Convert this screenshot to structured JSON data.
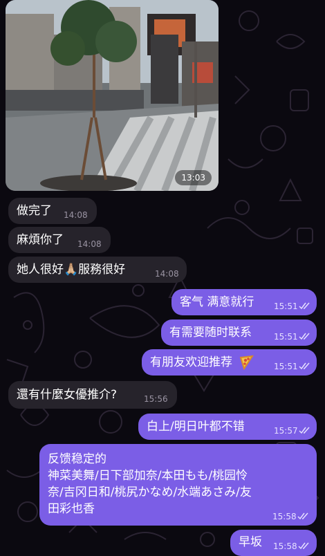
{
  "chat": {
    "photo": {
      "time": "13:03"
    },
    "messages": [
      {
        "dir": "in",
        "text": "做完了",
        "time": "14:08"
      },
      {
        "dir": "in",
        "text": "麻煩你了",
        "time": "14:08"
      },
      {
        "dir": "in",
        "text": "她人很好🙏🏼服務很好",
        "time": "14:08"
      },
      {
        "dir": "out",
        "text": "客气 满意就行",
        "time": "15:51",
        "read": true
      },
      {
        "dir": "out",
        "text": "有需要随时联系",
        "time": "15:51",
        "read": true
      },
      {
        "dir": "out",
        "text": "有朋友欢迎推荐",
        "emoji": "pizza-emoji",
        "time": "15:51",
        "read": true
      },
      {
        "dir": "in",
        "text": "還有什麼女優推介?",
        "time": "15:56"
      },
      {
        "dir": "out",
        "text": "白上/明日叶都不错",
        "time": "15:57",
        "read": true
      },
      {
        "dir": "out",
        "lines": [
          "反馈稳定的",
          "神菜美舞/日下部加奈/本田もも/桃园怜",
          "奈/吉冈日和/桃尻かなめ/水端あさみ/友",
          "田彩也香"
        ],
        "time": "15:58",
        "read": true
      },
      {
        "dir": "out",
        "text": "早坂",
        "time": "15:58",
        "read": true
      }
    ]
  },
  "colors": {
    "background": "#0b0910",
    "incoming": "#26232b",
    "outgoing": "#7b5ee6",
    "doodle": "#2b2433"
  }
}
